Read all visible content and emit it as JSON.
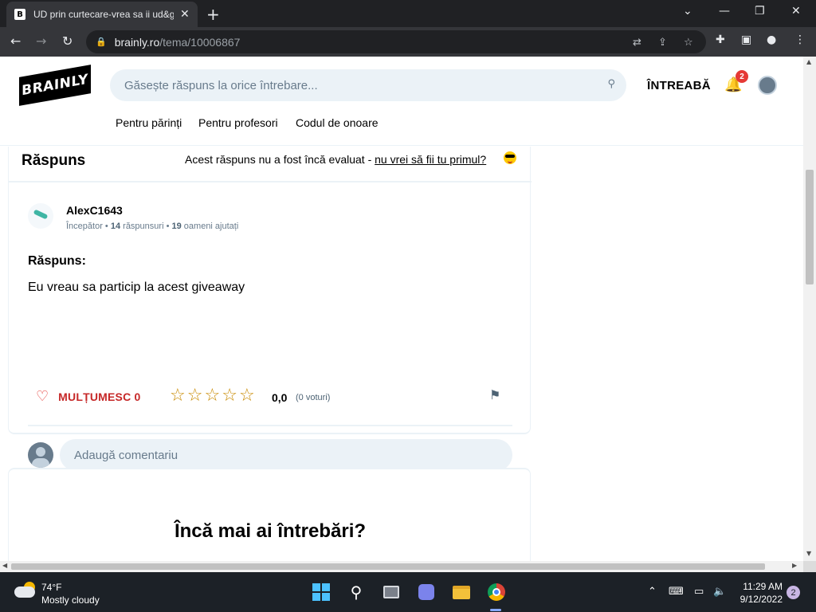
{
  "browser": {
    "tab_title": "UD prin curtecare-vrea sa ii ud&g",
    "tab_favicon": "B",
    "tab_close": "✕",
    "new_tab": "+",
    "url_host": "brainly.ro",
    "url_path": "/tema/10006867",
    "window_controls": {
      "tabs_menu": "⌄",
      "minimize": "—",
      "restore": "❐",
      "close": "✕"
    },
    "nav": {
      "back": "←",
      "forward": "→",
      "reload": "↻"
    }
  },
  "site": {
    "logo_text": "BRAINLY",
    "search_placeholder": "Găsește răspuns la orice întrebare...",
    "ask_label": "ÎNTREABĂ",
    "notification_count": "2",
    "subnav": [
      "Pentru părinți",
      "Pentru profesori",
      "Codul de onoare"
    ]
  },
  "answer_card": {
    "title": "Răspuns",
    "rating_note_prefix": "Acest răspuns nu a fost încă evaluat - ",
    "rating_note_link": "nu vrei să fii tu primul?",
    "username": "AlexC1643",
    "user_rank": "Începător",
    "answers_count": "14",
    "answers_label": "răspunsuri",
    "helped_count": "19",
    "helped_label": "oameni ajutați",
    "answer_label": "Răspuns:",
    "answer_text": "Eu vreau sa particip la acest giveaway",
    "thanks_label": "MULȚUMESC 0",
    "stars": [
      "☆",
      "☆",
      "☆",
      "☆",
      "☆"
    ],
    "rating_value": "0,0",
    "votes_text": "(0 voturi)",
    "comment_placeholder": "Adaugă comentariu"
  },
  "more_questions": {
    "heading": "Încă mai ai întrebări?"
  },
  "taskbar": {
    "temperature": "74°F",
    "condition": "Mostly cloudy",
    "time": "11:29 AM",
    "date": "9/12/2022",
    "notification_count": "2"
  },
  "colors": {
    "accent_red": "#c62828",
    "star_gold": "#c98a00",
    "search_bg": "#ebf2f7"
  }
}
